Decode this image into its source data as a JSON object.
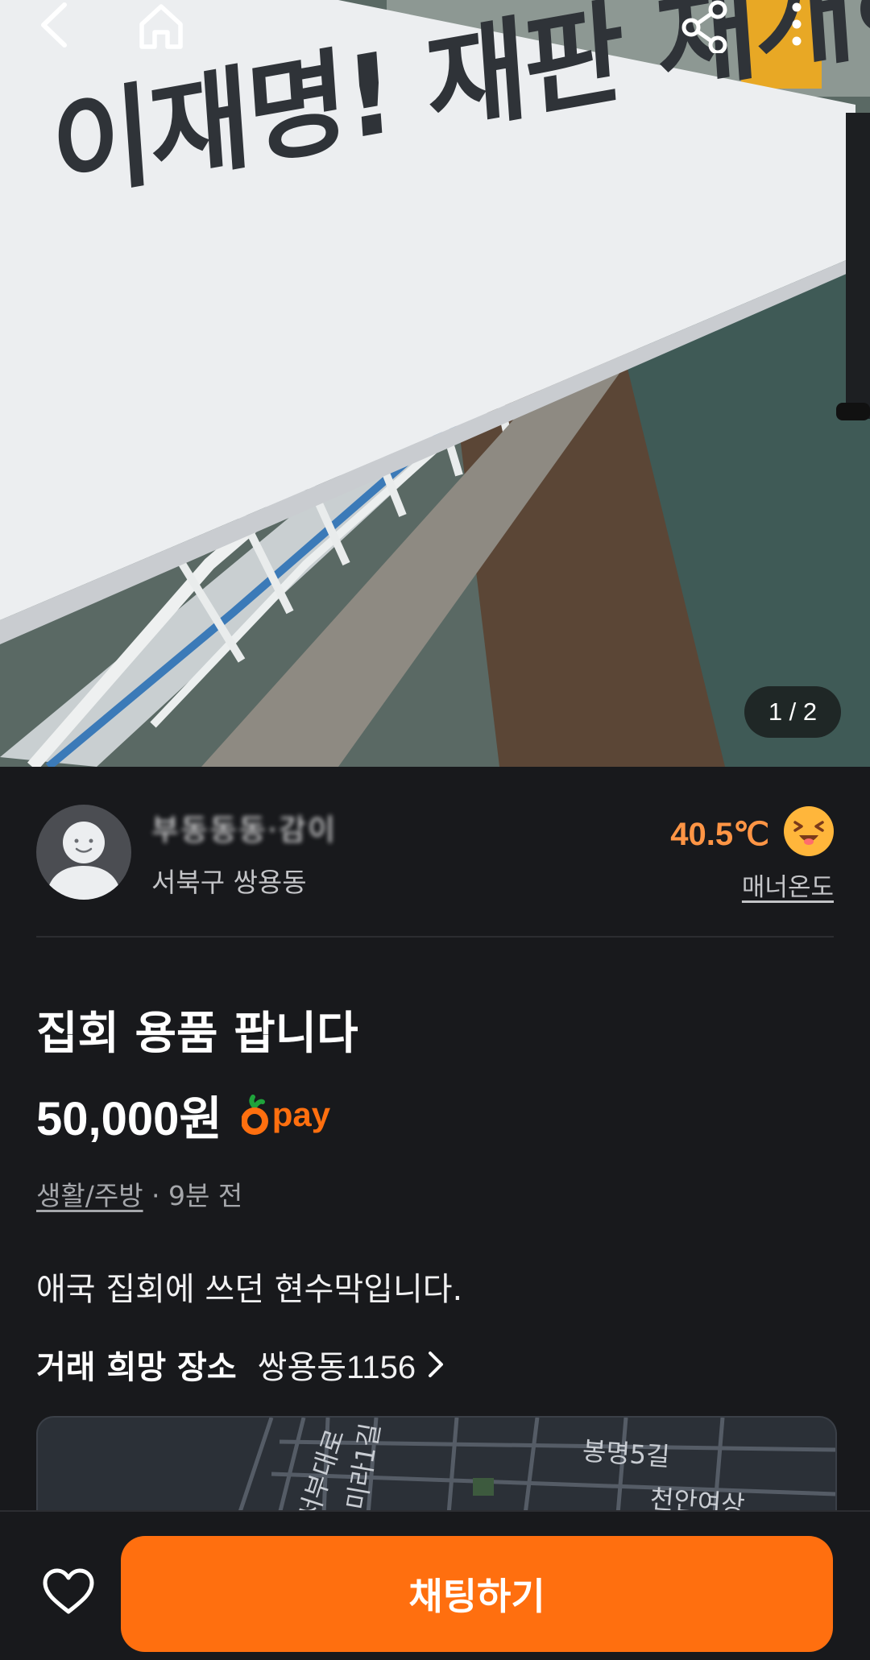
{
  "photo": {
    "banner_text": "이재명! 재판 재개하라!",
    "counter": "1 / 2"
  },
  "topbar": {
    "back_icon": "chevron-left-icon",
    "home_icon": "home-icon",
    "share_icon": "share-icon",
    "more_icon": "more-vertical-icon"
  },
  "seller": {
    "name": "부동동동·감이",
    "location": "서북구 쌍용동",
    "temperature": "40.5℃",
    "manner_label": "매너온도"
  },
  "product": {
    "title": "집회 용품 팝니다",
    "price": "50,000원",
    "pay_label": "pay",
    "category": "생활/주방",
    "time": " · 9분 전",
    "description": "애국 집회에 쓰던 현수막입니다.",
    "place_label": "거래 희망 장소",
    "place_value": "쌍용동1156"
  },
  "map": {
    "labels": [
      "봉명5길",
      "천안여상",
      "미라1길",
      "서부대로"
    ]
  },
  "bottom": {
    "chat_button": "채팅하기"
  },
  "colors": {
    "accent": "#ff6f0f",
    "temperature": "#ff9545",
    "background": "#18191c"
  }
}
